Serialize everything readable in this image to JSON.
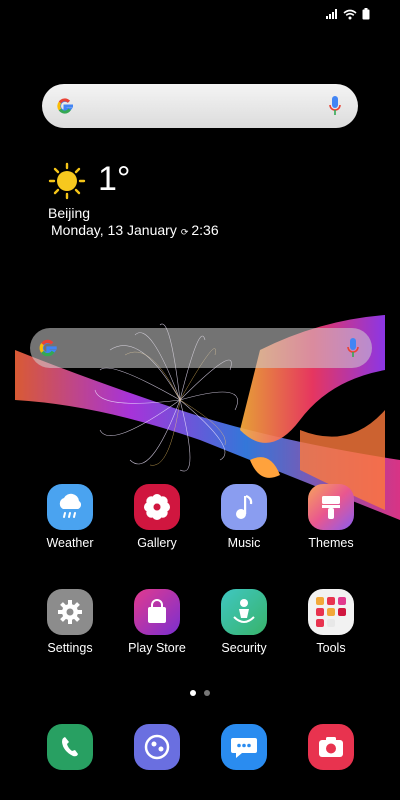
{
  "weather_widget": {
    "temperature": "1°",
    "city": "Beijing",
    "date": "Monday, 13 January",
    "time": "2:36"
  },
  "apps_row1": [
    {
      "label": "Weather",
      "icon": "cloud-rain-icon"
    },
    {
      "label": "Gallery",
      "icon": "flower-icon"
    },
    {
      "label": "Music",
      "icon": "music-note-icon"
    },
    {
      "label": "Themes",
      "icon": "paintbrush-icon"
    }
  ],
  "apps_row2": [
    {
      "label": "Settings",
      "icon": "gear-icon"
    },
    {
      "label": "Play Store",
      "icon": "shopping-bag-icon"
    },
    {
      "label": "Security",
      "icon": "person-shield-icon"
    },
    {
      "label": "Tools",
      "icon": "folder-icon"
    }
  ],
  "dock": [
    {
      "icon": "phone-icon"
    },
    {
      "icon": "chat-bubble-icon"
    },
    {
      "icon": "message-icon"
    },
    {
      "icon": "camera-icon"
    }
  ],
  "page_indicator": {
    "total": 2,
    "active": 1
  },
  "colors": {
    "weather": "#4aa3f0",
    "gallery": "#d0163f",
    "music": "#8a9df0",
    "themes": "#e9578f",
    "settings": "#8c8c8c",
    "play_store": "#9b2fc4",
    "security": "#38b36a",
    "phone": "#28a062",
    "messages": "#6a6fe0",
    "chat": "#2a8cf0",
    "camera": "#e8334f"
  }
}
